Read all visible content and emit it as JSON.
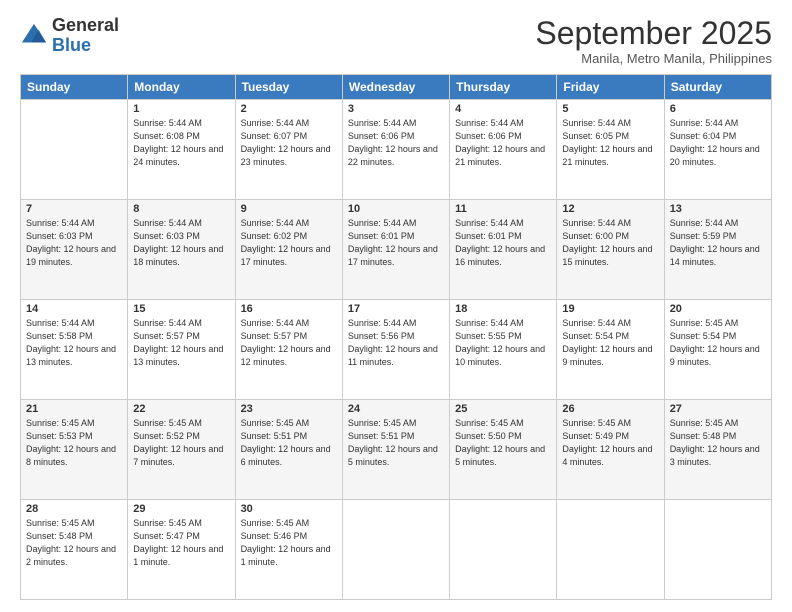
{
  "logo": {
    "general": "General",
    "blue": "Blue"
  },
  "header": {
    "month": "September 2025",
    "location": "Manila, Metro Manila, Philippines"
  },
  "days": [
    "Sunday",
    "Monday",
    "Tuesday",
    "Wednesday",
    "Thursday",
    "Friday",
    "Saturday"
  ],
  "weeks": [
    [
      {
        "day": "",
        "sunrise": "",
        "sunset": "",
        "daylight": ""
      },
      {
        "day": "1",
        "sunrise": "Sunrise: 5:44 AM",
        "sunset": "Sunset: 6:08 PM",
        "daylight": "Daylight: 12 hours and 24 minutes."
      },
      {
        "day": "2",
        "sunrise": "Sunrise: 5:44 AM",
        "sunset": "Sunset: 6:07 PM",
        "daylight": "Daylight: 12 hours and 23 minutes."
      },
      {
        "day": "3",
        "sunrise": "Sunrise: 5:44 AM",
        "sunset": "Sunset: 6:06 PM",
        "daylight": "Daylight: 12 hours and 22 minutes."
      },
      {
        "day": "4",
        "sunrise": "Sunrise: 5:44 AM",
        "sunset": "Sunset: 6:06 PM",
        "daylight": "Daylight: 12 hours and 21 minutes."
      },
      {
        "day": "5",
        "sunrise": "Sunrise: 5:44 AM",
        "sunset": "Sunset: 6:05 PM",
        "daylight": "Daylight: 12 hours and 21 minutes."
      },
      {
        "day": "6",
        "sunrise": "Sunrise: 5:44 AM",
        "sunset": "Sunset: 6:04 PM",
        "daylight": "Daylight: 12 hours and 20 minutes."
      }
    ],
    [
      {
        "day": "7",
        "sunrise": "Sunrise: 5:44 AM",
        "sunset": "Sunset: 6:03 PM",
        "daylight": "Daylight: 12 hours and 19 minutes."
      },
      {
        "day": "8",
        "sunrise": "Sunrise: 5:44 AM",
        "sunset": "Sunset: 6:03 PM",
        "daylight": "Daylight: 12 hours and 18 minutes."
      },
      {
        "day": "9",
        "sunrise": "Sunrise: 5:44 AM",
        "sunset": "Sunset: 6:02 PM",
        "daylight": "Daylight: 12 hours and 17 minutes."
      },
      {
        "day": "10",
        "sunrise": "Sunrise: 5:44 AM",
        "sunset": "Sunset: 6:01 PM",
        "daylight": "Daylight: 12 hours and 17 minutes."
      },
      {
        "day": "11",
        "sunrise": "Sunrise: 5:44 AM",
        "sunset": "Sunset: 6:01 PM",
        "daylight": "Daylight: 12 hours and 16 minutes."
      },
      {
        "day": "12",
        "sunrise": "Sunrise: 5:44 AM",
        "sunset": "Sunset: 6:00 PM",
        "daylight": "Daylight: 12 hours and 15 minutes."
      },
      {
        "day": "13",
        "sunrise": "Sunrise: 5:44 AM",
        "sunset": "Sunset: 5:59 PM",
        "daylight": "Daylight: 12 hours and 14 minutes."
      }
    ],
    [
      {
        "day": "14",
        "sunrise": "Sunrise: 5:44 AM",
        "sunset": "Sunset: 5:58 PM",
        "daylight": "Daylight: 12 hours and 13 minutes."
      },
      {
        "day": "15",
        "sunrise": "Sunrise: 5:44 AM",
        "sunset": "Sunset: 5:57 PM",
        "daylight": "Daylight: 12 hours and 13 minutes."
      },
      {
        "day": "16",
        "sunrise": "Sunrise: 5:44 AM",
        "sunset": "Sunset: 5:57 PM",
        "daylight": "Daylight: 12 hours and 12 minutes."
      },
      {
        "day": "17",
        "sunrise": "Sunrise: 5:44 AM",
        "sunset": "Sunset: 5:56 PM",
        "daylight": "Daylight: 12 hours and 11 minutes."
      },
      {
        "day": "18",
        "sunrise": "Sunrise: 5:44 AM",
        "sunset": "Sunset: 5:55 PM",
        "daylight": "Daylight: 12 hours and 10 minutes."
      },
      {
        "day": "19",
        "sunrise": "Sunrise: 5:44 AM",
        "sunset": "Sunset: 5:54 PM",
        "daylight": "Daylight: 12 hours and 9 minutes."
      },
      {
        "day": "20",
        "sunrise": "Sunrise: 5:45 AM",
        "sunset": "Sunset: 5:54 PM",
        "daylight": "Daylight: 12 hours and 9 minutes."
      }
    ],
    [
      {
        "day": "21",
        "sunrise": "Sunrise: 5:45 AM",
        "sunset": "Sunset: 5:53 PM",
        "daylight": "Daylight: 12 hours and 8 minutes."
      },
      {
        "day": "22",
        "sunrise": "Sunrise: 5:45 AM",
        "sunset": "Sunset: 5:52 PM",
        "daylight": "Daylight: 12 hours and 7 minutes."
      },
      {
        "day": "23",
        "sunrise": "Sunrise: 5:45 AM",
        "sunset": "Sunset: 5:51 PM",
        "daylight": "Daylight: 12 hours and 6 minutes."
      },
      {
        "day": "24",
        "sunrise": "Sunrise: 5:45 AM",
        "sunset": "Sunset: 5:51 PM",
        "daylight": "Daylight: 12 hours and 5 minutes."
      },
      {
        "day": "25",
        "sunrise": "Sunrise: 5:45 AM",
        "sunset": "Sunset: 5:50 PM",
        "daylight": "Daylight: 12 hours and 5 minutes."
      },
      {
        "day": "26",
        "sunrise": "Sunrise: 5:45 AM",
        "sunset": "Sunset: 5:49 PM",
        "daylight": "Daylight: 12 hours and 4 minutes."
      },
      {
        "day": "27",
        "sunrise": "Sunrise: 5:45 AM",
        "sunset": "Sunset: 5:48 PM",
        "daylight": "Daylight: 12 hours and 3 minutes."
      }
    ],
    [
      {
        "day": "28",
        "sunrise": "Sunrise: 5:45 AM",
        "sunset": "Sunset: 5:48 PM",
        "daylight": "Daylight: 12 hours and 2 minutes."
      },
      {
        "day": "29",
        "sunrise": "Sunrise: 5:45 AM",
        "sunset": "Sunset: 5:47 PM",
        "daylight": "Daylight: 12 hours and 1 minute."
      },
      {
        "day": "30",
        "sunrise": "Sunrise: 5:45 AM",
        "sunset": "Sunset: 5:46 PM",
        "daylight": "Daylight: 12 hours and 1 minute."
      },
      {
        "day": "",
        "sunrise": "",
        "sunset": "",
        "daylight": ""
      },
      {
        "day": "",
        "sunrise": "",
        "sunset": "",
        "daylight": ""
      },
      {
        "day": "",
        "sunrise": "",
        "sunset": "",
        "daylight": ""
      },
      {
        "day": "",
        "sunrise": "",
        "sunset": "",
        "daylight": ""
      }
    ]
  ]
}
